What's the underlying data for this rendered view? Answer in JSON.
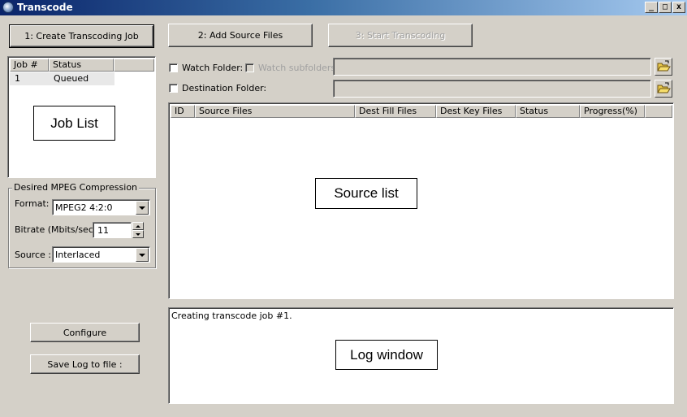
{
  "window": {
    "title": "Transcode",
    "minimize_glyph": "_",
    "maximize_glyph": "□",
    "close_glyph": "x"
  },
  "toolbar": {
    "create_job_label": "1: Create Transcoding Job",
    "add_source_label": "2: Add Source Files",
    "start_label": "3: Start Transcoding"
  },
  "job_list": {
    "columns": [
      "Job #",
      "Status"
    ],
    "rows": [
      {
        "job": "1",
        "status": "Queued"
      }
    ],
    "callout": "Job  List"
  },
  "compression": {
    "group_title": "Desired MPEG Compression",
    "format_label": "Format:",
    "format_value": "MPEG2 4:2:0",
    "bitrate_label": "Bitrate (Mbits/sec)",
    "bitrate_value": "11",
    "source_label": "Source :",
    "source_value": "Interlaced"
  },
  "folders": {
    "watch_folder_label": "Watch Folder:",
    "watch_subfolders_label": "Watch subfolders",
    "destination_folder_label": "Destination Folder:",
    "watch_folder_value": "",
    "destination_folder_value": ""
  },
  "source_list": {
    "columns": [
      "ID",
      "Source Files",
      "Dest Fill Files",
      "Dest Key Files",
      "Status",
      "Progress(%)"
    ],
    "callout": "Source list"
  },
  "log": {
    "lines": [
      "Creating transcode job #1."
    ],
    "callout": "Log window"
  },
  "side_buttons": {
    "configure_label": "Configure",
    "save_log_label": "Save Log to file :"
  },
  "icons": {
    "app": "transcode-app-icon",
    "folder": "open-folder-icon"
  }
}
